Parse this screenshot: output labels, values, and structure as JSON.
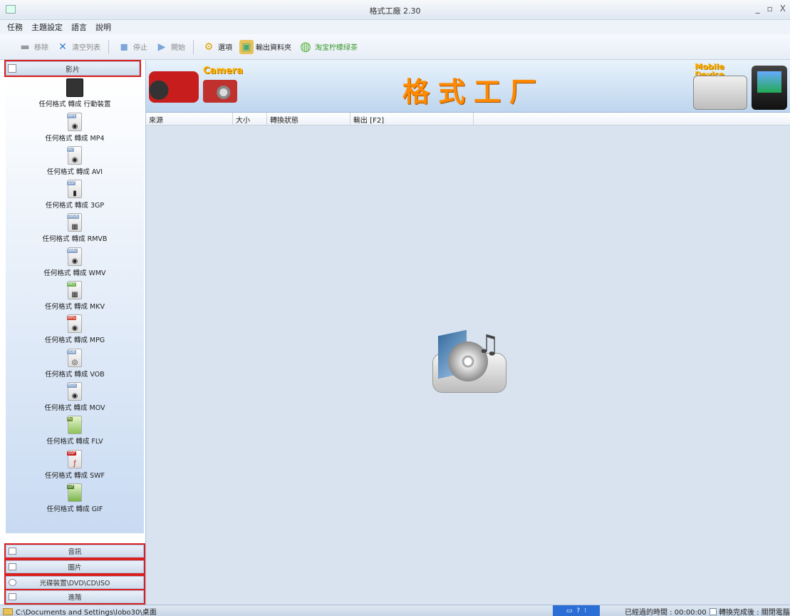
{
  "window": {
    "title": "格式工廠 2.30",
    "minimize": "_",
    "maximize": "▫",
    "close": "X"
  },
  "menu": [
    "任務",
    "主題設定",
    "語言",
    "說明"
  ],
  "toolbar": {
    "remove": "移除",
    "clear_list": "清空列表",
    "stop": "停止",
    "start": "開始",
    "options": "選項",
    "output_folder": "輸出資料夾",
    "taobao": "淘宝柠檬绿茶"
  },
  "sidebar": {
    "video_header": "影片",
    "items": [
      {
        "label": "任何格式 轉成 行動裝置",
        "tag": ""
      },
      {
        "label": "任何格式 轉成 MP4",
        "tag": "MP4"
      },
      {
        "label": "任何格式 轉成 AVI",
        "tag": "AVI"
      },
      {
        "label": "任何格式 轉成 3GP",
        "tag": "3GP"
      },
      {
        "label": "任何格式 轉成 RMVB",
        "tag": "RMVB"
      },
      {
        "label": "任何格式 轉成 WMV",
        "tag": "WMV"
      },
      {
        "label": "任何格式 轉成 MKV",
        "tag": "MKV"
      },
      {
        "label": "任何格式 轉成 MPG",
        "tag": "MPG"
      },
      {
        "label": "任何格式 轉成 VOB",
        "tag": "VOB"
      },
      {
        "label": "任何格式 轉成 MOV",
        "tag": "MOV"
      },
      {
        "label": "任何格式 轉成 FLV",
        "tag": "flv"
      },
      {
        "label": "任何格式 轉成 SWF",
        "tag": "SWF"
      },
      {
        "label": "任何格式 轉成 GIF",
        "tag": "GIF"
      }
    ],
    "audio": "音訊",
    "picture": "圖片",
    "rom_device": "光碟裝置\\DVD\\CD\\ISO",
    "advanced": "進階"
  },
  "banner": {
    "camera": "Camera",
    "brand": "格式工厂",
    "mobile": "Mobile Device"
  },
  "list": {
    "columns": [
      "來源",
      "大小",
      "轉換狀態",
      "輸出 [F2]"
    ]
  },
  "statusbar": {
    "path": "C:\\Documents and Settings\\lobo30\\桌面",
    "elapsed": "已經過的時間 : 00:00:00",
    "after_convert": "轉換完成後 : 關閉電腦"
  },
  "colors": {
    "accent_orange": "#ff8a00",
    "highlight_red": "#d9201e",
    "list_bg": "#d8e3ef"
  }
}
